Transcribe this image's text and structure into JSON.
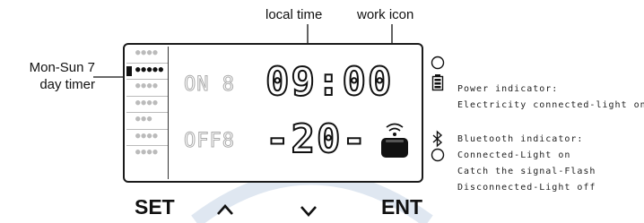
{
  "labels": {
    "local_time": "local time",
    "work_icon": "work icon",
    "day_timer_line1": "Mon-Sun 7",
    "day_timer_line2": "day timer"
  },
  "display": {
    "time": "09:00",
    "temperature": "-20-",
    "on_segment": "ON 8",
    "off_segment": "OFF8"
  },
  "day_rows": 7,
  "active_day_index": 1,
  "indicators": {
    "power_title": "Power indicator:",
    "power_text": "Electricity connected-light on",
    "bluetooth_title": "Bluetooth indicator:",
    "bluetooth_lines": [
      "Connected-Light on",
      "Catch the signal-Flash",
      "Disconnected-Light off"
    ]
  },
  "buttons": {
    "set": "SET",
    "up": "^",
    "down": "v",
    "ent": "ENT"
  },
  "colors": {
    "line": "#111111",
    "ghost_segment": "#aaaaaa",
    "watermark": "#dfe7f1"
  },
  "icons": [
    "power-indicator-icon",
    "bluetooth-icon",
    "led-circle-icon",
    "work-signal-icon"
  ]
}
